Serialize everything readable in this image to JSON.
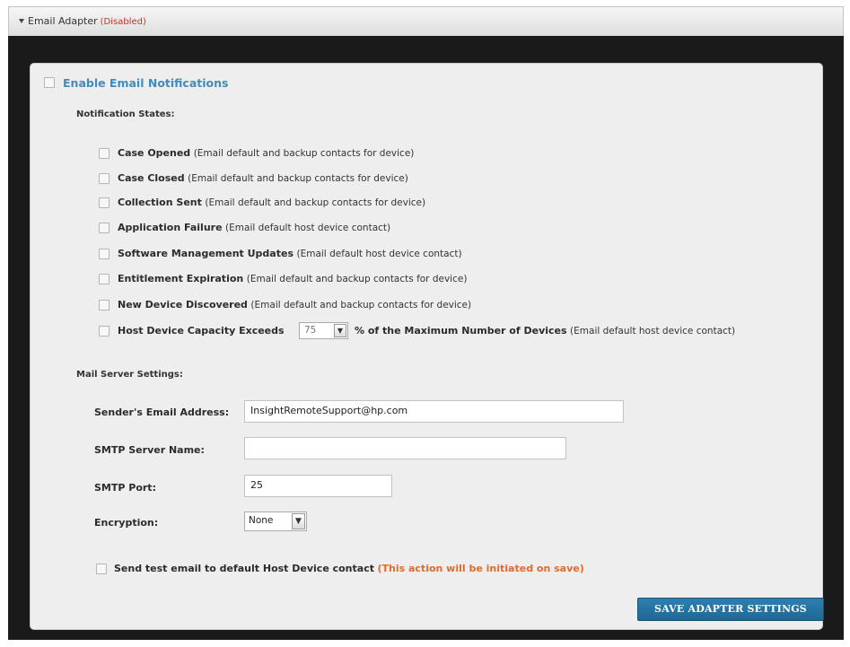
{
  "header": {
    "title": "Email Adapter",
    "state": "(Disabled)"
  },
  "enable": {
    "label": "Enable Email Notifications"
  },
  "notification_states": {
    "heading": "Notification States:",
    "items": [
      {
        "name": "Case Opened",
        "desc": "(Email default and backup contacts for device)"
      },
      {
        "name": "Case Closed",
        "desc": "(Email default and backup contacts for device)"
      },
      {
        "name": "Collection Sent",
        "desc": "(Email default and backup contacts for device)"
      },
      {
        "name": "Application Failure",
        "desc": "(Email default host device contact)"
      },
      {
        "name": "Software Management Updates",
        "desc": "(Email default host device contact)"
      },
      {
        "name": "Entitlement Expiration",
        "desc": "(Email default and backup contacts for device)"
      },
      {
        "name": "New Device Discovered",
        "desc": "(Email default and backup contacts for device)"
      }
    ],
    "capacity": {
      "prefix": "Host Device Capacity Exceeds",
      "value": "75",
      "suffix": "% of the Maximum Number of Devices",
      "desc": "(Email default host device contact)"
    }
  },
  "mail_server": {
    "heading": "Mail Server Settings:",
    "sender_label": "Sender's Email Address:",
    "sender_value": "InsightRemoteSupport@hp.com",
    "smtp_server_label": "SMTP Server Name:",
    "smtp_server_value": "",
    "smtp_port_label": "SMTP Port:",
    "smtp_port_value": "25",
    "encryption_label": "Encryption:",
    "encryption_value": "None"
  },
  "test_email": {
    "label": "Send test email to default Host Device contact",
    "note": "(This action will be initiated on save)"
  },
  "actions": {
    "save_label": "SAVE ADAPTER SETTINGS"
  }
}
